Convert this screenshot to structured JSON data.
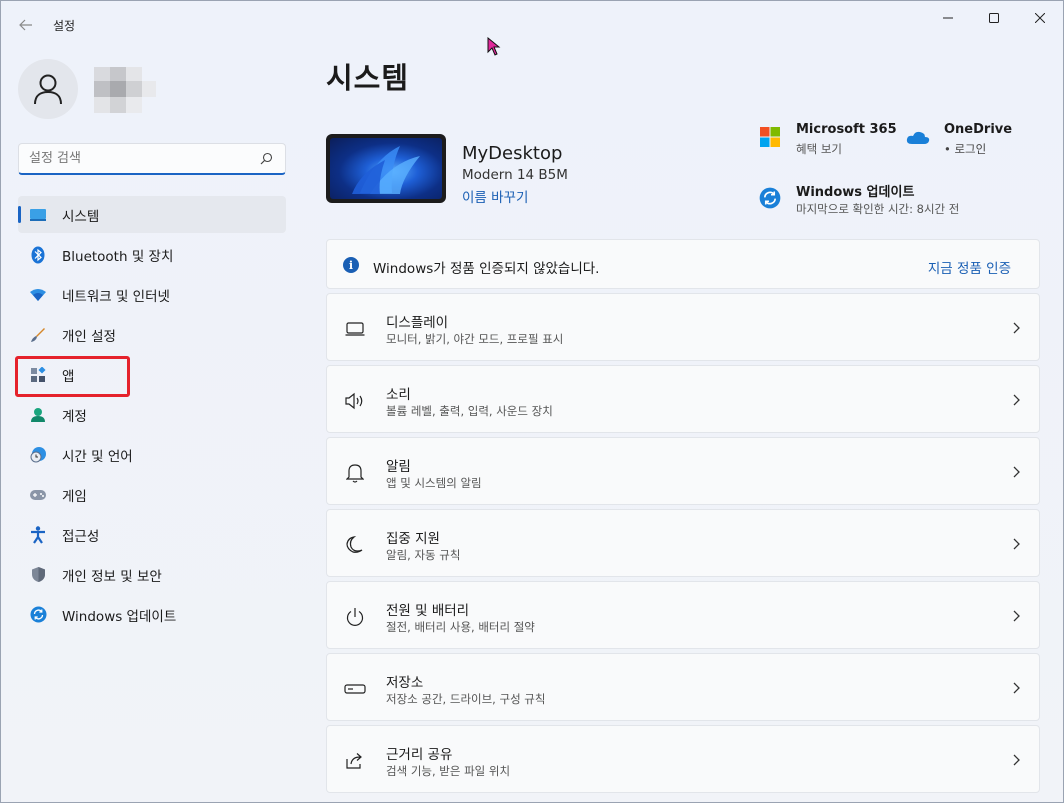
{
  "window": {
    "app_title": "설정"
  },
  "profile": {
    "avatar_icon": "person-icon"
  },
  "search": {
    "placeholder": "설정 검색",
    "value": ""
  },
  "sidebar": {
    "items": [
      {
        "label": "시스템",
        "icon": "monitor-icon",
        "active": true
      },
      {
        "label": "Bluetooth 및 장치",
        "icon": "bluetooth-icon"
      },
      {
        "label": "네트워크 및 인터넷",
        "icon": "wifi-icon"
      },
      {
        "label": "개인 설정",
        "icon": "paintbrush-icon"
      },
      {
        "label": "앱",
        "icon": "apps-icon"
      },
      {
        "label": "계정",
        "icon": "account-icon"
      },
      {
        "label": "시간 및 언어",
        "icon": "clock-globe-icon"
      },
      {
        "label": "게임",
        "icon": "gamepad-icon"
      },
      {
        "label": "접근성",
        "icon": "accessibility-icon"
      },
      {
        "label": "개인 정보 및 보안",
        "icon": "shield-icon"
      },
      {
        "label": "Windows 업데이트",
        "icon": "update-icon"
      }
    ]
  },
  "main": {
    "title": "시스템",
    "device": {
      "name": "MyDesktop",
      "model": "Modern 14 B5M",
      "rename_link": "이름 바꾸기"
    },
    "quick": {
      "m365": {
        "title": "Microsoft 365",
        "sub": "혜택 보기"
      },
      "onedrive": {
        "title": "OneDrive",
        "sub": "• 로그인"
      },
      "update": {
        "title": "Windows 업데이트",
        "sub": "마지막으로 확인한 시간: 8시간 전"
      }
    },
    "banner": {
      "text": "Windows가 정품 인증되지 않았습니다.",
      "link": "지금 정품 인증"
    },
    "cards": [
      {
        "title": "디스플레이",
        "sub": "모니터, 밝기, 야간 모드, 프로필 표시",
        "icon": "display-icon"
      },
      {
        "title": "소리",
        "sub": "볼륨 레벨, 출력, 입력, 사운드 장치",
        "icon": "speaker-icon"
      },
      {
        "title": "알림",
        "sub": "앱 및 시스템의 알림",
        "icon": "bell-icon"
      },
      {
        "title": "집중 지원",
        "sub": "알림, 자동 규칙",
        "icon": "moon-icon"
      },
      {
        "title": "전원 및 배터리",
        "sub": "절전, 배터리 사용, 배터리 절약",
        "icon": "power-icon"
      },
      {
        "title": "저장소",
        "sub": "저장소 공간, 드라이브, 구성 규칙",
        "icon": "storage-icon"
      },
      {
        "title": "근거리 공유",
        "sub": "검색 기능, 받은 파일 위치",
        "icon": "share-icon"
      }
    ]
  },
  "colors": {
    "accent": "#1a64c4",
    "highlight": "#e5222c"
  }
}
